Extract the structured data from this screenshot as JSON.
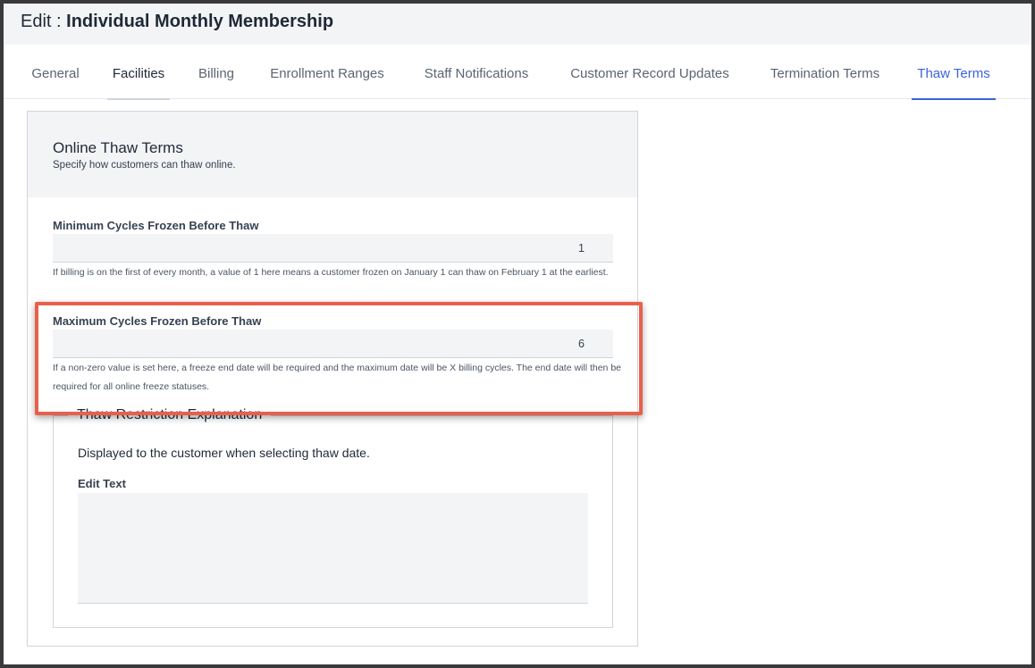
{
  "header": {
    "title_prefix": "Edit : ",
    "title_name": "Individual Monthly Membership"
  },
  "tabs": [
    {
      "label": "General"
    },
    {
      "label": "Facilities"
    },
    {
      "label": "Billing"
    },
    {
      "label": "Enrollment Ranges"
    },
    {
      "label": "Staff Notifications"
    },
    {
      "label": "Customer Record Updates"
    },
    {
      "label": "Termination Terms"
    },
    {
      "label": "Thaw Terms"
    }
  ],
  "active_tab": "Thaw Terms",
  "colors": {
    "accent": "#3b63d9",
    "highlight": "#e8604c"
  },
  "card": {
    "title": "Online Thaw Terms",
    "subtitle": "Specify how customers can thaw online."
  },
  "fields": {
    "min_cycles": {
      "label": "Minimum Cycles Frozen Before Thaw",
      "value": "1",
      "help": "If billing is on the first of every month, a value of 1 here means a customer frozen on January 1 can thaw on February 1 at the earliest."
    },
    "max_cycles": {
      "label": "Maximum Cycles Frozen Before Thaw",
      "value": "6",
      "help": "If a non-zero value is set here, a freeze end date will be required and the maximum date will be X billing cycles. The end date will then be required for all online freeze statuses."
    }
  },
  "thaw_restriction": {
    "legend": "Thaw Restriction Explanation",
    "description": "Displayed to the customer when selecting thaw date.",
    "edit_label": "Edit Text",
    "text": ""
  }
}
